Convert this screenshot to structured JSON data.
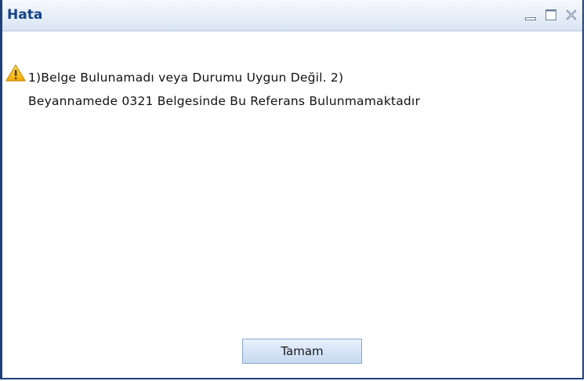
{
  "dialog": {
    "title": "Hata",
    "message": "1)Belge Bulunamadı veya Durumu Uygun Değil. 2)\nBeyannamede 0321 Belgesinde Bu Referans Bulunmamaktadır",
    "ok_label": "Tamam",
    "icon": "warning-icon"
  },
  "window_controls": [
    "minimize-icon",
    "maximize-icon",
    "close-icon"
  ],
  "colors": {
    "title_text": "#15428b",
    "frame": "#1f3f7a",
    "warning": "#f5b800"
  }
}
